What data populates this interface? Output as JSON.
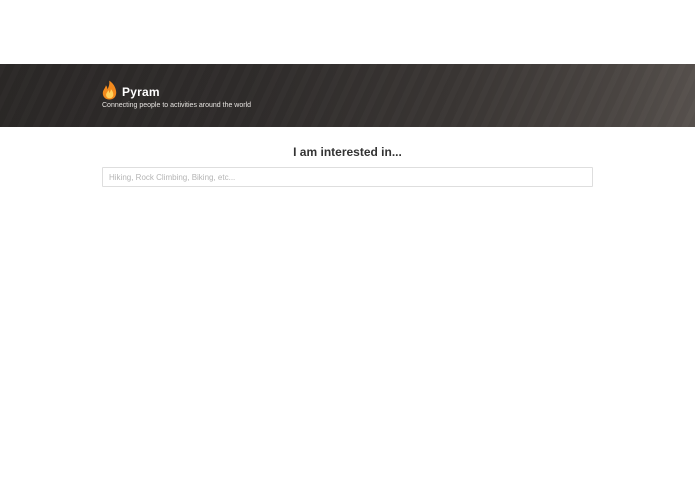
{
  "header": {
    "brand_name": "Pyram",
    "tagline": "Connecting people to activities around the world",
    "logo_icon": "flame-icon",
    "accent_color": "#f28a1e"
  },
  "main": {
    "headline": "I am interested in...",
    "search": {
      "value": "",
      "placeholder": "Hiking, Rock Climbing, Biking, etc..."
    }
  }
}
